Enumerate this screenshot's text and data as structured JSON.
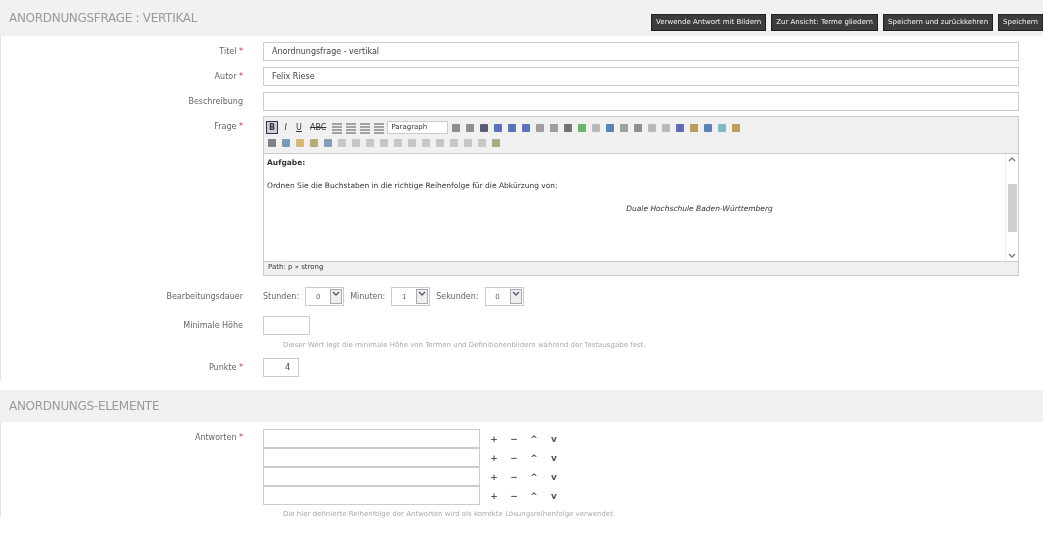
{
  "header": {
    "title": "ANORDNUNGSFRAGE : VERTIKAL",
    "buttons": [
      "Verwende Antwort mit Bildern",
      "Zur Ansicht: Terme gliedern",
      "Speichern und zurückkehren",
      "Speichern"
    ]
  },
  "fields": [
    {
      "label": "Titel",
      "required_mark": "*",
      "value": "Anordnungsfrage - vertikal"
    },
    {
      "label": "Autor",
      "required_mark": "*",
      "value": "Felix Riese"
    },
    {
      "label": "Beschreibung"
    }
  ],
  "question": {
    "label": "Frage",
    "required_mark": "*",
    "toolbar": {
      "format_buttons": [
        "B",
        "I",
        "U",
        "ABC"
      ],
      "format_select": "Paragraph"
    },
    "content": {
      "heading": "Aufgabe:",
      "text": "Ordnen Sie die Buchstaben in die richtige Reihenfolge für die Abkürzung von:",
      "quote": "Duale Hochschule Baden-Württemberg"
    },
    "path": "Path: p » strong"
  },
  "duration": {
    "label": "Bearbeitungsdauer",
    "parts": [
      {
        "label": "Stunden:",
        "value": "0"
      },
      {
        "label": "Minuten:",
        "value": "1"
      },
      {
        "label": "Sekunden:",
        "value": "0"
      }
    ]
  },
  "min_height": {
    "label": "Minimale Höhe",
    "help": "Dieser Wert legt die minimale Höhe von Termen und Definitionenbildern während der Testausgabe fest."
  },
  "points": {
    "label": "Punkte",
    "required_mark": "*",
    "value": "4"
  },
  "section": {
    "title": "ANORDNUNGS-ELEMENTE",
    "label": "Antworten",
    "required_mark": "*",
    "answers": [
      {
        "actions": [
          "+",
          "−",
          "^",
          "v"
        ]
      },
      {
        "actions": [
          "+",
          "−",
          "^",
          "v"
        ]
      },
      {
        "actions": [
          "+",
          "−",
          "^",
          "v"
        ]
      },
      {
        "actions": [
          "+",
          "−",
          "^",
          "v"
        ]
      }
    ],
    "help": "Die hier definierte Reihenfolge der Antworten wird als korrekte Lösungsreihenfolge verwendet."
  }
}
